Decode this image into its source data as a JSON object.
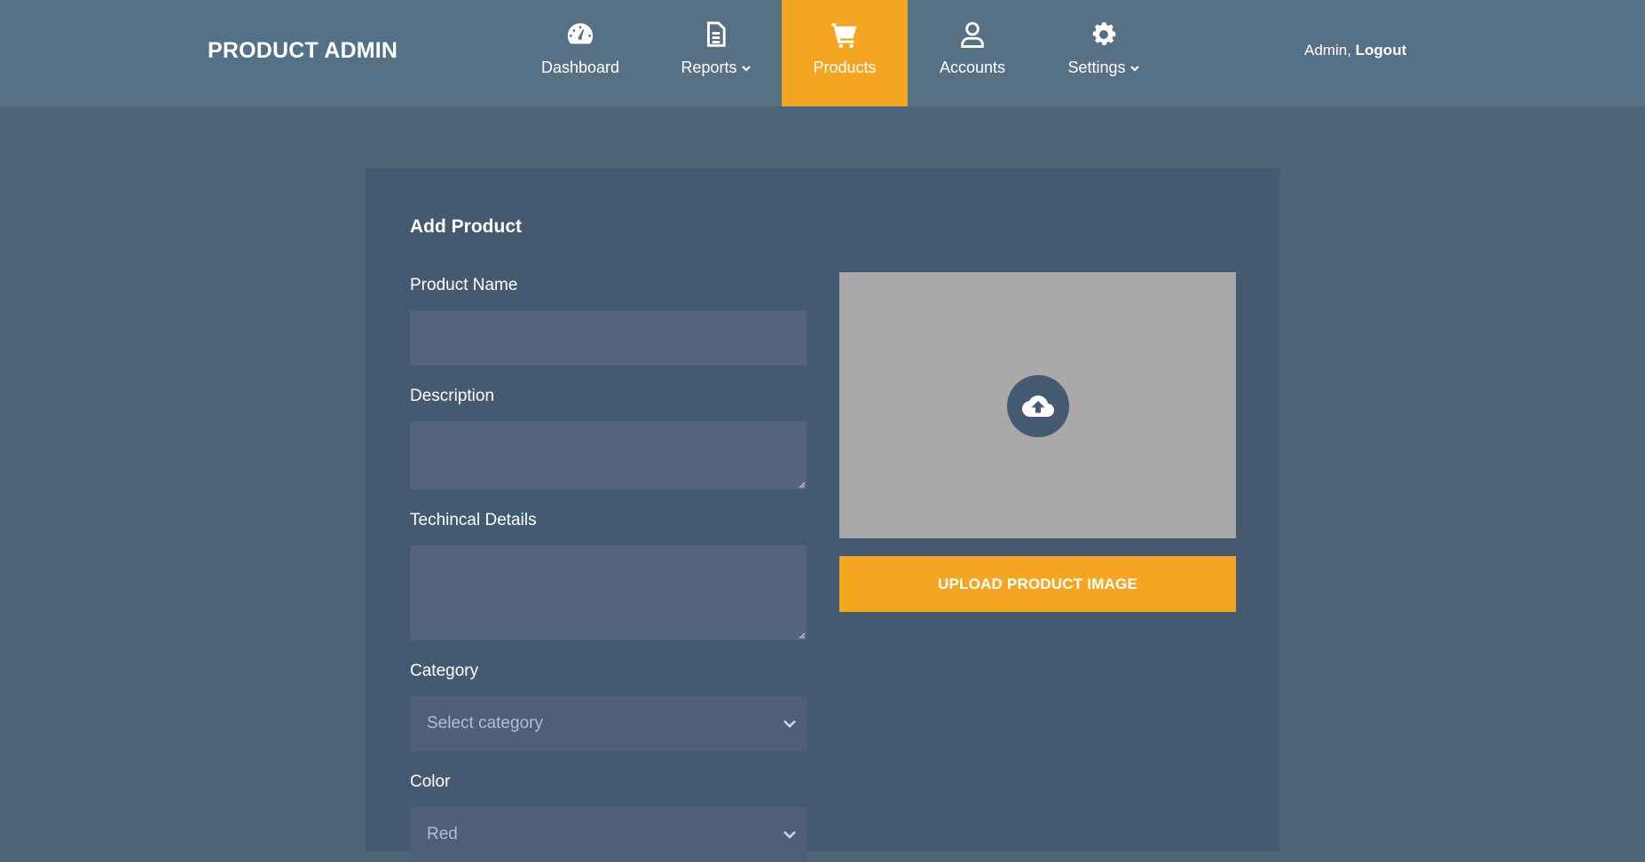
{
  "brand": "PRODUCT ADMIN",
  "nav": {
    "items": [
      {
        "label": "Dashboard",
        "icon": "dashboard-icon",
        "has_dropdown": false,
        "active": false
      },
      {
        "label": "Reports",
        "icon": "file-icon",
        "has_dropdown": true,
        "active": false
      },
      {
        "label": "Products",
        "icon": "shopping-cart-icon",
        "has_dropdown": false,
        "active": true
      },
      {
        "label": "Accounts",
        "icon": "user-icon",
        "has_dropdown": false,
        "active": false
      },
      {
        "label": "Settings",
        "icon": "gear-icon",
        "has_dropdown": true,
        "active": false
      }
    ]
  },
  "user": {
    "name": "Admin,",
    "logout_label": "Logout"
  },
  "form": {
    "title": "Add Product",
    "product_name": {
      "label": "Product Name",
      "value": ""
    },
    "description": {
      "label": "Description",
      "value": ""
    },
    "technical_details": {
      "label": "Techincal Details",
      "value": ""
    },
    "category": {
      "label": "Category",
      "selected": "Select category"
    },
    "color": {
      "label": "Color",
      "selected": "Red"
    }
  },
  "image": {
    "upload_icon": "cloud-upload-icon",
    "button_label": "UPLOAD PRODUCT IMAGE"
  },
  "colors": {
    "accent": "#f4a623",
    "navbar": "#567086",
    "page_background": "#4e6479",
    "card_background": "#435a70",
    "input_background": "#54647d",
    "image_placeholder": "#a9a9a9"
  }
}
